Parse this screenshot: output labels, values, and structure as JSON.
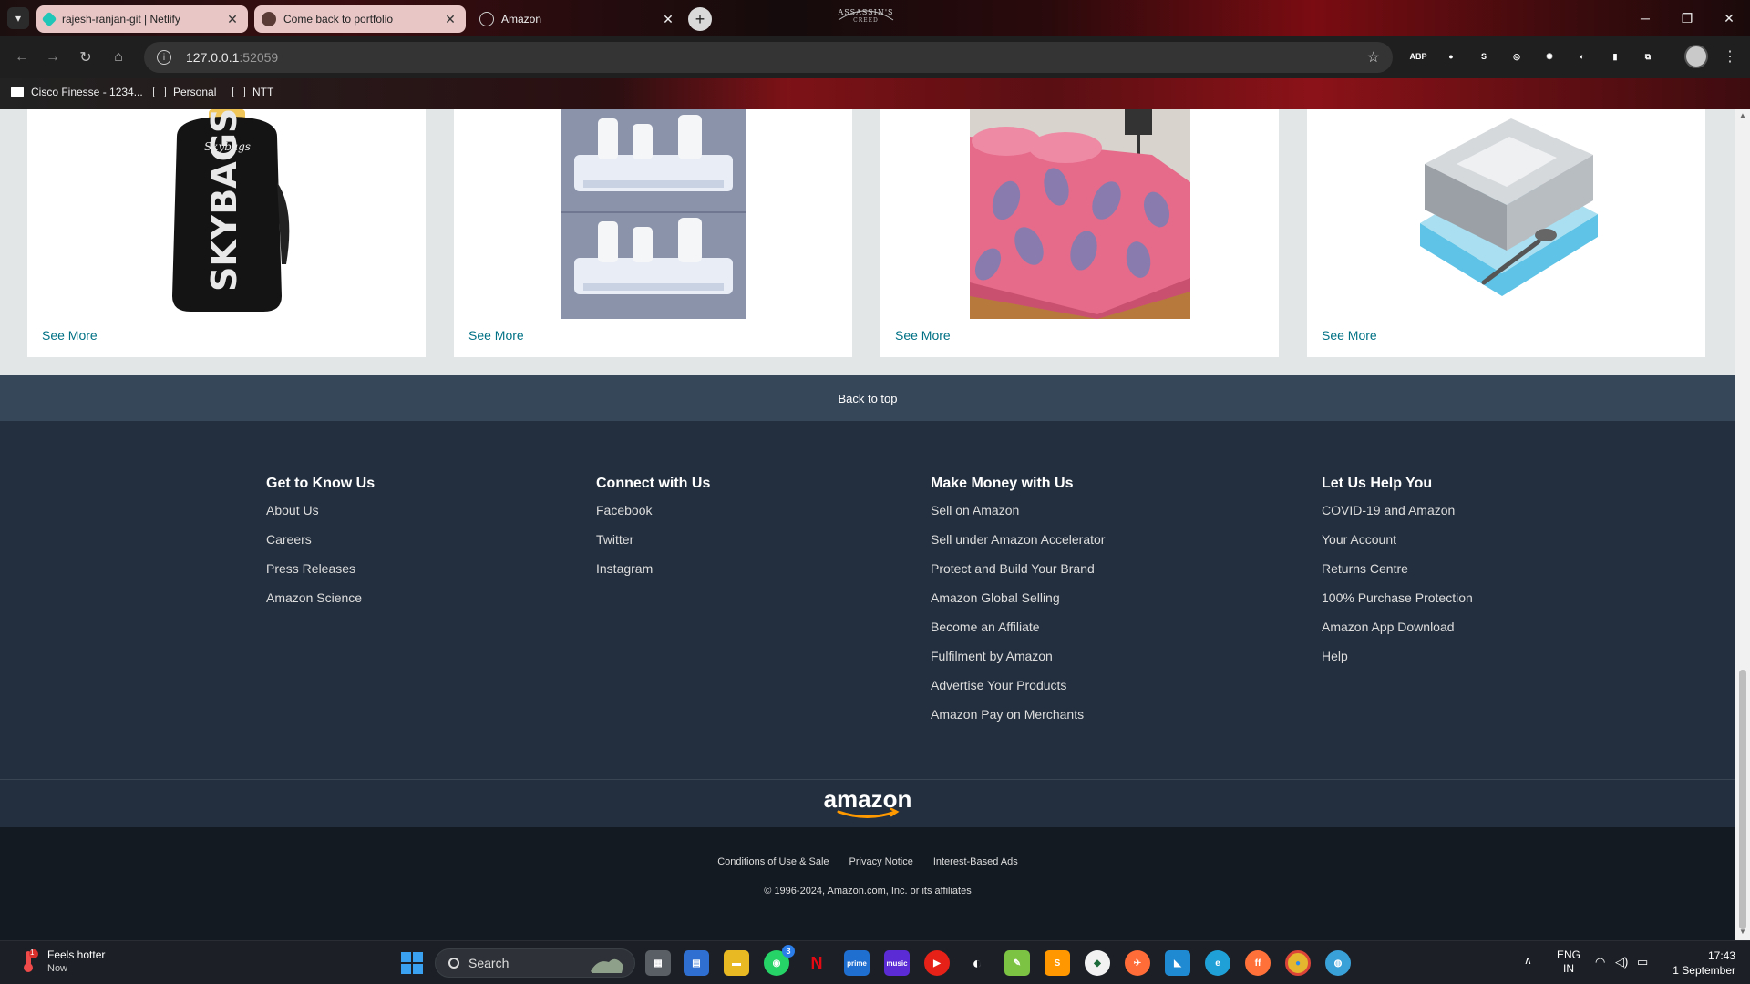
{
  "browser": {
    "tabs": [
      {
        "title": "rajesh-ranjan-git | Netlify",
        "favicon_color": "#20c6b7",
        "active": false
      },
      {
        "title": "Come back to portfolio",
        "favicon_color": "#5a3b35",
        "active": false
      },
      {
        "title": "Amazon",
        "favicon_color": "#cfcfcf",
        "active": true
      }
    ],
    "address": {
      "host": "127.0.0.1",
      "port": ":52059"
    },
    "bookmarks": [
      "Cisco Finesse - 1234...",
      "Personal",
      "NTT"
    ],
    "extensions": [
      {
        "label": "ABP",
        "color": "#c9252d"
      },
      {
        "label": "●",
        "color": "#d7262e"
      },
      {
        "label": "S",
        "color": "#2f6fb3"
      },
      {
        "label": "◎",
        "color": "#444"
      },
      {
        "label": "✺",
        "color": "#444"
      },
      {
        "label": "◐",
        "color": "#2e8b57"
      },
      {
        "label": "▮",
        "color": "#3b6fd1"
      },
      {
        "label": "⧉",
        "color": "#444"
      }
    ],
    "logo_text": "ASSASSIN'S CREED"
  },
  "products": [
    {
      "see_more": "See More",
      "image": "backpack"
    },
    {
      "see_more": "See More",
      "image": "shower-caddy"
    },
    {
      "see_more": "See More",
      "image": "bedsheet"
    },
    {
      "see_more": "See More",
      "image": "lunch-box"
    }
  ],
  "footer": {
    "back_to_top": "Back to top",
    "columns": [
      {
        "title": "Get to Know Us",
        "links": [
          "About Us",
          "Careers",
          "Press Releases",
          "Amazon Science"
        ]
      },
      {
        "title": "Connect with Us",
        "links": [
          "Facebook",
          "Twitter",
          "Instagram"
        ]
      },
      {
        "title": "Make Money with Us",
        "links": [
          "Sell on Amazon",
          "Sell under Amazon Accelerator",
          "Protect and Build Your Brand",
          "Amazon Global Selling",
          "Become an Affiliate",
          "Fulfilment by Amazon",
          "Advertise Your Products",
          "Amazon Pay on Merchants"
        ]
      },
      {
        "title": "Let Us Help You",
        "links": [
          "COVID-19 and Amazon",
          "Your Account",
          "Returns Centre",
          "100% Purchase Protection",
          "Amazon App Download",
          "Help"
        ]
      }
    ],
    "logo_text": "amazon",
    "legal_links": [
      "Conditions of Use & Sale",
      "Privacy Notice",
      "Interest-Based Ads"
    ],
    "copyright": "© 1996-2024, Amazon.com, Inc. or its affiliates"
  },
  "taskbar": {
    "weather_title": "Feels hotter",
    "weather_sub": "Now",
    "weather_badge": "1",
    "search_label": "Search",
    "whatsapp_badge": "3",
    "lang_line1": "ENG",
    "lang_line2": "IN",
    "time": "17:43",
    "date": "1 September",
    "apps": [
      {
        "name": "task-view",
        "label": "▦",
        "color": "#5a5f66"
      },
      {
        "name": "store",
        "label": "▤",
        "color": "#2f6fd1"
      },
      {
        "name": "file-explorer",
        "label": "▬",
        "color": "#e8b923"
      },
      {
        "name": "whatsapp",
        "label": "◉",
        "color": "#25d366"
      },
      {
        "name": "netflix",
        "label": "N",
        "color": "#1c2026"
      },
      {
        "name": "prime-video",
        "label": "prime",
        "color": "#1f6fd1"
      },
      {
        "name": "amazon-music",
        "label": "music",
        "color": "#5b2bd6"
      },
      {
        "name": "youtube",
        "label": "▶",
        "color": "#e62117"
      },
      {
        "name": "github",
        "label": "◐",
        "color": "#1c2026"
      },
      {
        "name": "notepad",
        "label": "✎",
        "color": "#7cc243"
      },
      {
        "name": "sublime",
        "label": "S",
        "color": "#ff9800"
      },
      {
        "name": "mongodb",
        "label": "◆",
        "color": "#f2f2f2"
      },
      {
        "name": "postman",
        "label": "✈",
        "color": "#ff6c37"
      },
      {
        "name": "vscode",
        "label": "◣",
        "color": "#1f8ad2"
      },
      {
        "name": "edge",
        "label": "e",
        "color": "#1fa1d8"
      },
      {
        "name": "firefox",
        "label": "ff",
        "color": "#ff7139"
      },
      {
        "name": "chrome",
        "label": "●",
        "color": "#e4b52f"
      },
      {
        "name": "globe",
        "label": "◍",
        "color": "#3aa0d8"
      }
    ]
  }
}
